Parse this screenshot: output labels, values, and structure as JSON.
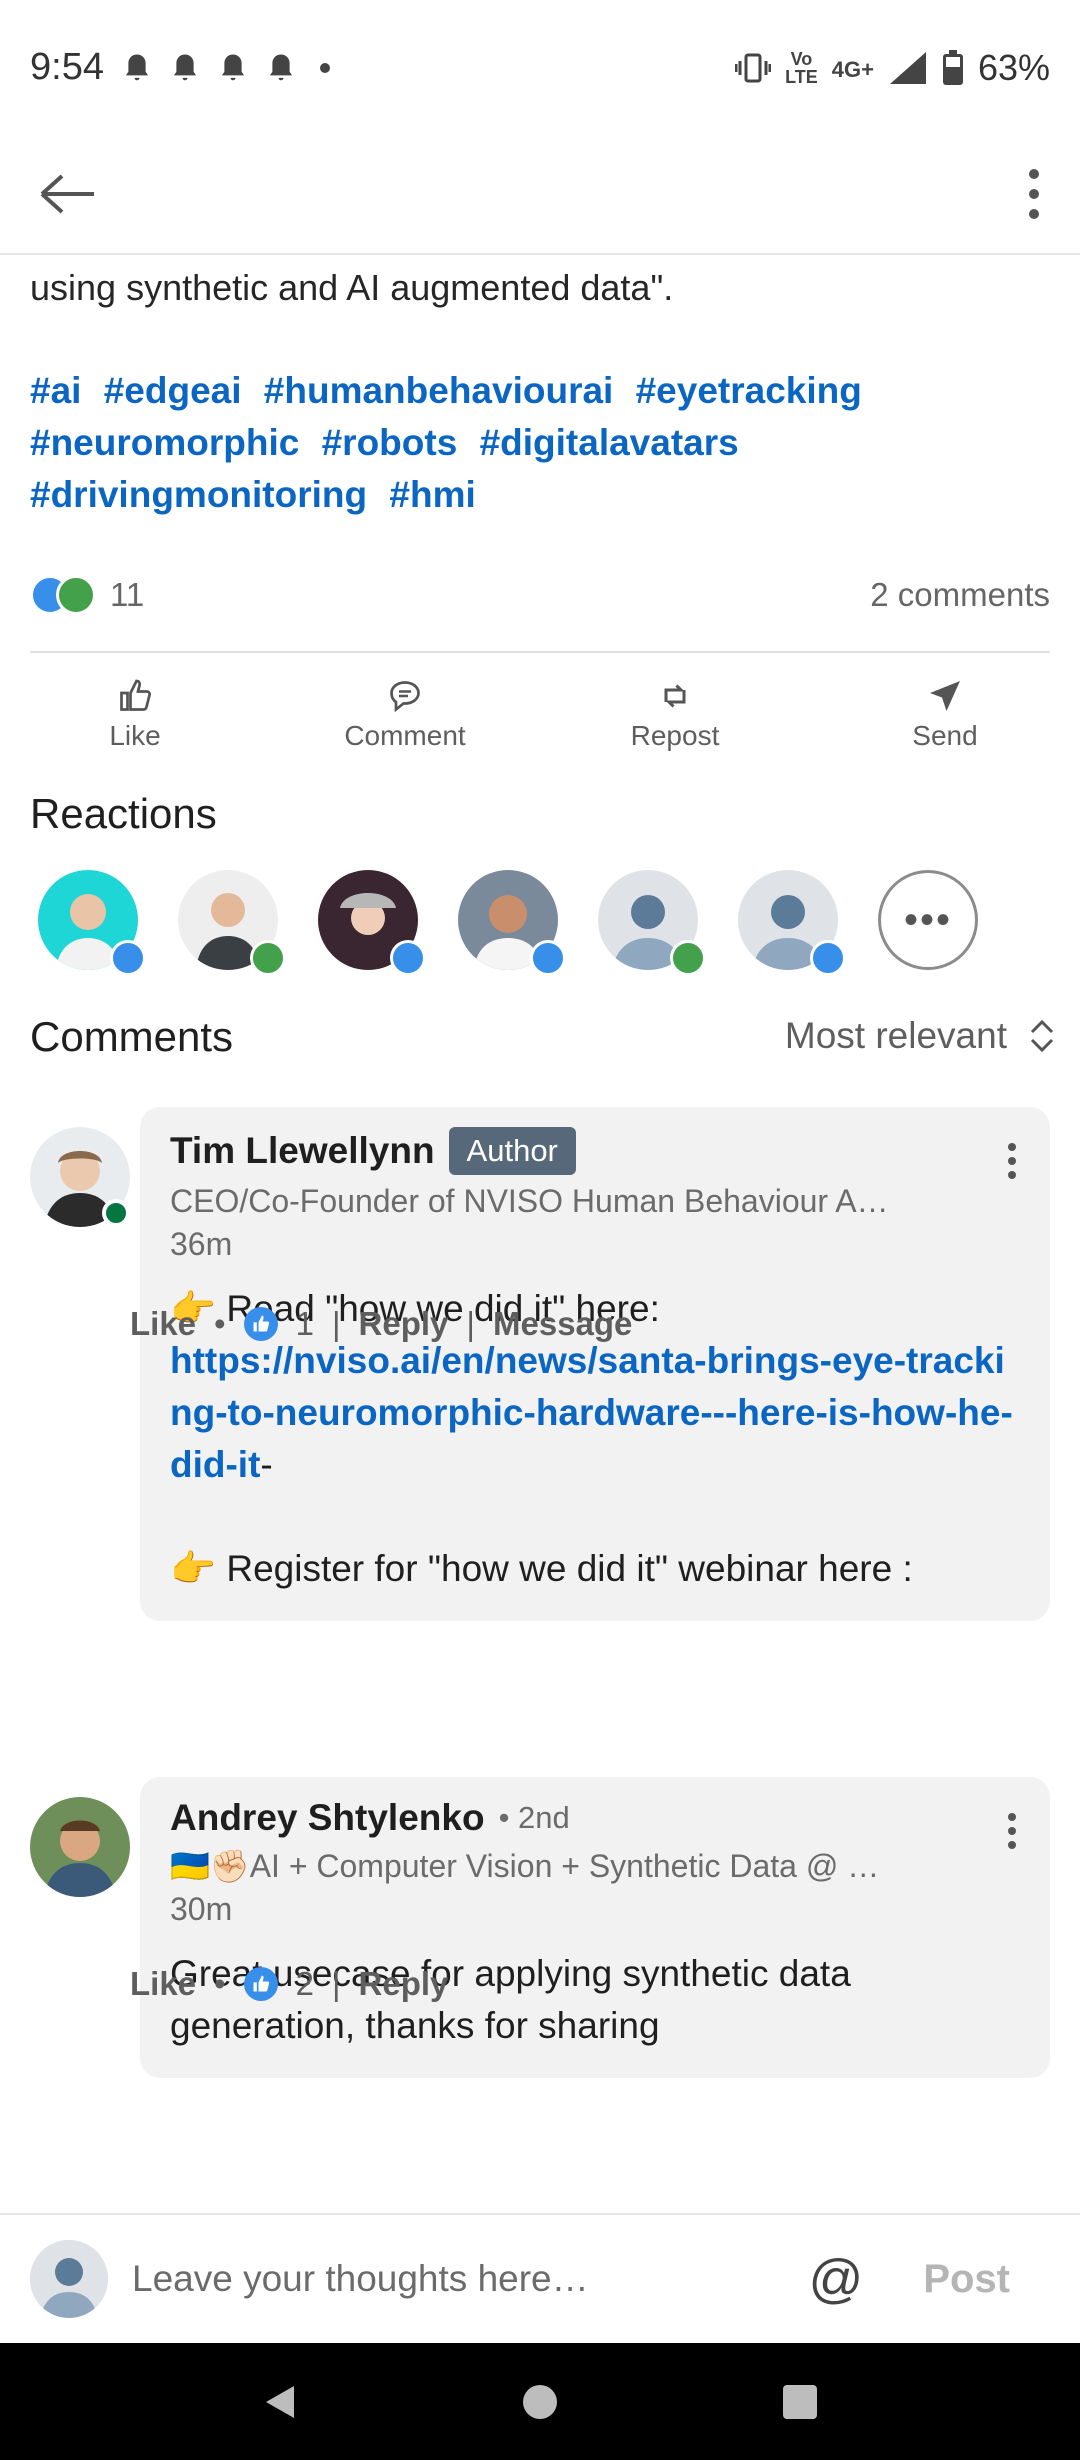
{
  "status": {
    "time": "9:54",
    "network": "4G+",
    "volte_top": "Vo",
    "volte_bottom": "LTE",
    "battery": "63%"
  },
  "post": {
    "text_tail": "using synthetic and AI augmented data\".",
    "hashtags": [
      "#ai",
      "#edgeai",
      "#humanbehaviourai",
      "#eyetracking",
      "#neuromorphic",
      "#robots",
      "#digitalavatars",
      "#drivingmonitoring",
      "#hmi"
    ],
    "reaction_count": "11",
    "comments_count": "2 comments"
  },
  "actions": {
    "like": "Like",
    "comment": "Comment",
    "repost": "Repost",
    "send": "Send"
  },
  "reactions": {
    "title": "Reactions"
  },
  "comments_section": {
    "title": "Comments",
    "sort_label": "Most relevant"
  },
  "comments": [
    {
      "name": "Tim Llewellynn",
      "badge": "Author",
      "subtitle": "CEO/Co-Founder of NVISO Human Behaviour A…",
      "time": "36m",
      "line1": "👉 Read \"how we did it\" here:",
      "link": "https://nviso.ai/en/news/santa-brings-eye-tracking-to-neuromorphic-hardware---here-is-how-he-did-it",
      "link_suffix": "-",
      "line2": "👉 Register for \"how we did it\" webinar here :",
      "like": "Like",
      "like_count": "1",
      "reply": "Reply",
      "message": "Message"
    },
    {
      "name": "Andrey Shtylenko",
      "degree": "• 2nd",
      "subtitle": "🇺🇦✊🏻AI + Computer Vision + Synthetic Data @ …",
      "time": "30m",
      "text": "Great usecase for applying synthetic data generation, thanks for sharing",
      "like": "Like",
      "like_count": "2",
      "reply": "Reply"
    }
  ],
  "composer": {
    "placeholder": "Leave your thoughts here…",
    "at": "@",
    "post": "Post"
  },
  "colors": {
    "link": "#0a66c2",
    "like": "#378fe9",
    "support": "#44a14b",
    "author_badge": "#56687a"
  }
}
